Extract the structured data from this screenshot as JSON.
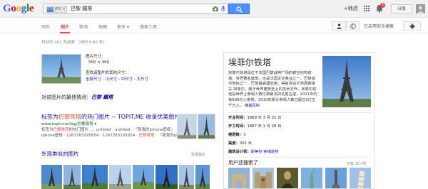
{
  "header": {
    "logo": "Google",
    "search_chip": "JPG",
    "query": "巴黎 鐵塔",
    "plus_name": "+韩虎",
    "notifications": "1",
    "share_label": "分享"
  },
  "tabs": [
    {
      "label": "网页",
      "active": false
    },
    {
      "label": "图片",
      "active": true
    },
    {
      "label": "新闻",
      "active": false
    },
    {
      "label": "地图",
      "active": false
    },
    {
      "label": "更多 ▾",
      "active": false
    },
    {
      "label": "搜索工具",
      "active": false
    }
  ],
  "safe_search": "已启用安全搜索",
  "stats": "找到约 261 条结果 （用时 0.82 秒）",
  "image_info": {
    "size_label": "图片尺寸：",
    "size_value": "500 × 360",
    "other_sizes_label": "查找该图片的其他尺寸：",
    "size_links": "全部尺寸 - 小尺寸 - 中尺寸 - 大尺寸"
  },
  "best_guess": {
    "label": "对该图片的最佳猜测：",
    "value": "巴黎 鐵塔"
  },
  "result": {
    "title_pre": "标签为",
    "title_hl": "巴黎铁塔",
    "title_post": "的热门图片 -- TOPIT.ME 收录优美图片",
    "url": "www.topit.me/tag/巴黎铁塔 ▾",
    "snippet1_pre": "标签为",
    "snippet1_hl": "巴黎铁塔",
    "snippet1_post": "的热门图片. ... untitled · untitled · 『我我的iphone壁纸』",
    "snippet2_pre": "iphone壁纸 · 1267283295654 · 1267283295654 · ",
    "snippet2_hl": "巴黎铁塔",
    "snippet2_post": " · 『我我的iphone壁纸』"
  },
  "similar": {
    "title": "外观类似的图片",
    "report": "举报图片"
  },
  "knowledge_panel": {
    "title": "埃菲尔铁塔",
    "description": "埃菲尔铁塔是位于法国巴黎战神广场的镂空结构铁塔，世界著名建筑，也是法国文化象征之一，巴黎城市地标之一，巴黎最高建筑物，得名自设计师居斯塔夫·埃菲尔。属于世界建筑史上的技术杰作，埃菲尔铁塔是世界上参观人数付费最多的名胜古迹，2011年约有698万人参观。2010年累计参观人数已超过2亿五千万人。",
    "desc_link": "维基百科",
    "facts": [
      {
        "label": "开业时间：",
        "value": "1889 年 3 月 31 日",
        "link": false
      },
      {
        "label": "开工时间：",
        "value": "1887 年 1 月 28 日",
        "link": false
      },
      {
        "label": "楼层数：",
        "value": "3",
        "link": false
      },
      {
        "label": "高度：",
        "value": "301 米",
        "link": false
      },
      {
        "label": "建筑设计师：",
        "value": "斯蒂芬·索维斯特",
        "link": true
      }
    ],
    "also_searched": "用户还搜索了",
    "more": "还有 15+项"
  }
}
